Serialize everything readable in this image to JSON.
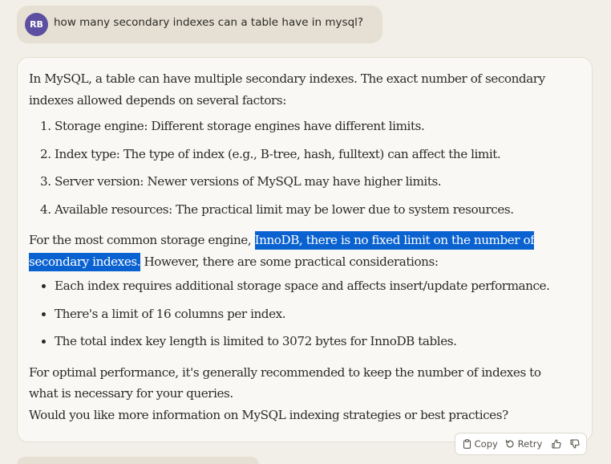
{
  "user_message": {
    "avatar_initials": "RB",
    "text": "how many secondary indexes can a table have in mysql?"
  },
  "response": {
    "intro": "In MySQL, a table can have multiple secondary indexes. The exact number of secondary indexes allowed depends on several factors:",
    "factors": [
      {
        "num": "1.",
        "text": "Storage engine: Different storage engines have different limits."
      },
      {
        "num": "2.",
        "text": "Index type: The type of index (e.g., B-tree, hash, fulltext) can affect the limit."
      },
      {
        "num": "3.",
        "text": "Server version: Newer versions of MySQL may have higher limits."
      },
      {
        "num": "4.",
        "text": "Available resources: The practical limit may be lower due to system resources."
      }
    ],
    "innodb_prefix": "For the most common storage engine, ",
    "innodb_highlight": "InnoDB, there is no fixed limit on the number of secondary indexes.",
    "innodb_suffix": " However, there are some practical considerations:",
    "considerations": [
      "Each index requires additional storage space and affects insert/update performance.",
      "There's a limit of 16 columns per index.",
      "The total index key length is limited to 3072 bytes for InnoDB tables."
    ],
    "optimal": "For optimal performance, it's generally recommended to keep the number of indexes to what is necessary for your queries.",
    "question": "Would you like more information on MySQL indexing strategies or best practices?"
  },
  "actions": {
    "copy_label": "Copy",
    "retry_label": "Retry",
    "copy_icon": "clipboard-icon",
    "retry_icon": "retry-icon",
    "thumbs_up_icon": "thumbs-up-icon",
    "thumbs_down_icon": "thumbs-down-icon"
  },
  "colors": {
    "background": "#f1efe7",
    "user_bubble": "#e5e0d3",
    "avatar": "#5c4fa1",
    "selection_highlight": "#0a62d0"
  }
}
